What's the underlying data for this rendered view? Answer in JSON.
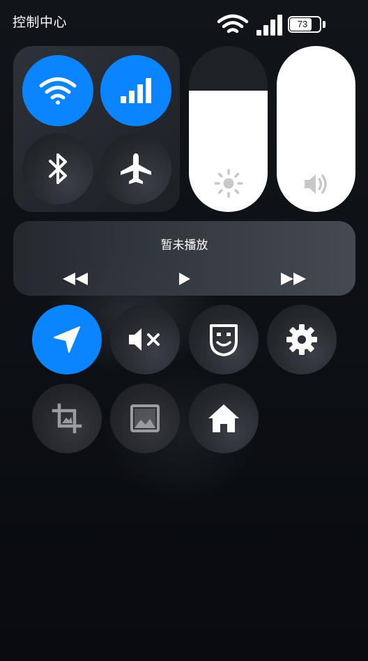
{
  "status_bar": {
    "title": "控制中心",
    "battery_level": 73,
    "battery_label": "73",
    "wifi_icon": "wifi-icon",
    "signal_icon": "cellular-signal-icon"
  },
  "connectivity": {
    "items": [
      {
        "name": "wifi",
        "icon": "wifi-icon",
        "active": true
      },
      {
        "name": "cellular",
        "icon": "cellular-signal-icon",
        "active": true
      },
      {
        "name": "bluetooth",
        "icon": "bluetooth-icon",
        "active": false
      },
      {
        "name": "airplane",
        "icon": "airplane-icon",
        "active": false
      }
    ]
  },
  "sliders": {
    "brightness": {
      "icon": "sun-icon",
      "level": 0.73
    },
    "volume": {
      "icon": "speaker-icon",
      "level": 1.0
    }
  },
  "media": {
    "now_playing": "暂未播放",
    "controls": [
      "rewind-icon",
      "play-icon",
      "fast-forward-icon"
    ]
  },
  "shortcuts": [
    {
      "name": "location",
      "icon": "location-arrow-icon",
      "active": true
    },
    {
      "name": "mute",
      "icon": "speaker-mute-icon",
      "active": false
    },
    {
      "name": "face",
      "icon": "face-mask-icon",
      "active": false
    },
    {
      "name": "settings",
      "icon": "gear-icon",
      "active": false
    },
    {
      "name": "screenshot-crop",
      "icon": "crop-icon",
      "active": false
    },
    {
      "name": "gallery",
      "icon": "image-icon",
      "active": false
    },
    {
      "name": "home",
      "icon": "home-icon",
      "active": false
    }
  ],
  "colors": {
    "accent": "#0a84ff",
    "background": "#0b0d11"
  }
}
